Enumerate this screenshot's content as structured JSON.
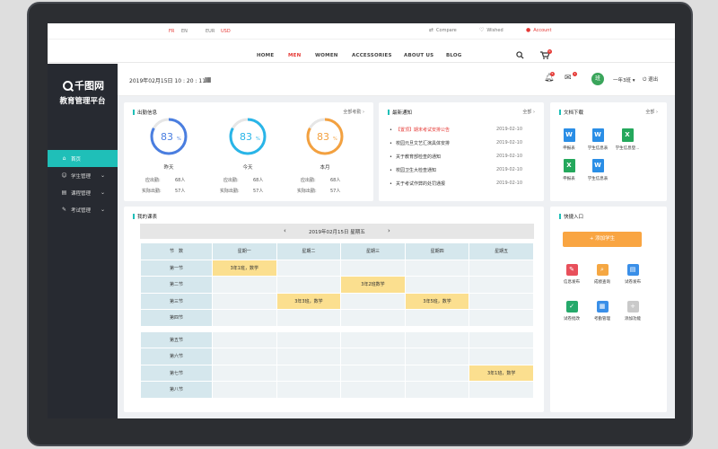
{
  "topbar": {
    "lang_fr": "FR",
    "lang_en": "EN",
    "cur_eur": "EUR",
    "cur_usd": "USD",
    "compare": "Compare",
    "wished": "Wished",
    "account": "Account"
  },
  "shopnav": {
    "home": "HOME",
    "men": "MEN",
    "women": "WOMEN",
    "accessories": "ACCESSORIES",
    "about": "ABOUT US",
    "blog": "BLOG",
    "cart_badge": "0"
  },
  "sidebar": {
    "logo": "千图网",
    "subtitle": "教育管理平台",
    "items": [
      {
        "label": "首页"
      },
      {
        "label": "学生管理"
      },
      {
        "label": "课程管理"
      },
      {
        "label": "考试管理"
      }
    ]
  },
  "header": {
    "datetime": "2019年02月15日  10 : 20 : 11",
    "bell_badge": "5",
    "mail_badge": "1",
    "avatar_text": "班",
    "username": "一年3班",
    "logout": "退出"
  },
  "attendance": {
    "title": "出勤信息",
    "more": "全部考勤",
    "items": [
      {
        "value": "83",
        "unit": "%",
        "label": "昨天",
        "expected_label": "应出勤:",
        "expected": "68人",
        "actual_label": "实际出勤:",
        "actual": "57人",
        "color": "#4a7ee0"
      },
      {
        "value": "83",
        "unit": "%",
        "label": "今天",
        "expected_label": "应出勤:",
        "expected": "68人",
        "actual_label": "实际出勤:",
        "actual": "57人",
        "color": "#29b5e8"
      },
      {
        "value": "83",
        "unit": "%",
        "label": "本月",
        "expected_label": "应出勤:",
        "expected": "68人",
        "actual_label": "实际出勤:",
        "actual": "57人",
        "color": "#f3a140"
      }
    ]
  },
  "notices": {
    "title": "最新通知",
    "more": "全部",
    "items": [
      {
        "title": "【置顶】期末考试安排公告",
        "date": "2019-02-10"
      },
      {
        "title": "校园元旦文艺汇演具体安排",
        "date": "2019-02-10"
      },
      {
        "title": "关于教育部检查的通知",
        "date": "2019-02-10"
      },
      {
        "title": "校园卫生大检查通知",
        "date": "2019-02-10"
      },
      {
        "title": "关于考试作弊的处罚通报",
        "date": "2019-02-10"
      }
    ]
  },
  "docs": {
    "title": "文档下载",
    "more": "全部",
    "items": [
      {
        "type": "W",
        "label": "申报表",
        "color": "#2a8ee6"
      },
      {
        "type": "W",
        "label": "学生信息表",
        "color": "#2a8ee6"
      },
      {
        "type": "X",
        "label": "学生信息登...",
        "color": "#24a85c"
      },
      {
        "type": "X",
        "label": "申报表",
        "color": "#24a85c"
      },
      {
        "type": "W",
        "label": "学生信息表",
        "color": "#2a8ee6"
      }
    ]
  },
  "schedule": {
    "title": "我的课表",
    "date": "2019年02月15日  星期五",
    "header_first": "节　数",
    "days": [
      "星期一",
      "星期二",
      "星期三",
      "星期四",
      "星期五"
    ],
    "rows": [
      {
        "label": "第一节",
        "cells": [
          "3年1班，数学",
          "",
          "",
          "",
          ""
        ]
      },
      {
        "label": "第二节",
        "cells": [
          "",
          "",
          "3年2班数学",
          "",
          ""
        ]
      },
      {
        "label": "第三节",
        "cells": [
          "",
          "3年3班，数学",
          "",
          "3年5班，数学",
          ""
        ]
      },
      {
        "label": "第四节",
        "cells": [
          "",
          "",
          "",
          "",
          ""
        ]
      },
      {
        "label": "第五节",
        "cells": [
          "",
          "",
          "",
          "",
          ""
        ]
      },
      {
        "label": "第六节",
        "cells": [
          "",
          "",
          "",
          "",
          ""
        ]
      },
      {
        "label": "第七节",
        "cells": [
          "",
          "",
          "",
          "",
          "3年1班，数学"
        ]
      },
      {
        "label": "第八节",
        "cells": [
          "",
          "",
          "",
          "",
          ""
        ]
      }
    ]
  },
  "quick": {
    "title": "快捷入口",
    "add_button": "+ 添加学生",
    "items": [
      {
        "label": "信息发布",
        "color": "#e8505b",
        "icon": "edit-icon",
        "glyph": "✎"
      },
      {
        "label": "成绩查询",
        "color": "#f5a742",
        "icon": "search-doc-icon",
        "glyph": "⌕"
      },
      {
        "label": "试卷发布",
        "color": "#3a8fe8",
        "icon": "doc-icon",
        "glyph": "▤"
      },
      {
        "label": "试卷批改",
        "color": "#26a96b",
        "icon": "check-icon",
        "glyph": "✓"
      },
      {
        "label": "考勤管理",
        "color": "#3a8fe8",
        "icon": "calendar-icon",
        "glyph": "▦"
      },
      {
        "label": "添加功能",
        "color": "#c9c9c9",
        "icon": "plus-icon",
        "glyph": "+"
      }
    ]
  }
}
